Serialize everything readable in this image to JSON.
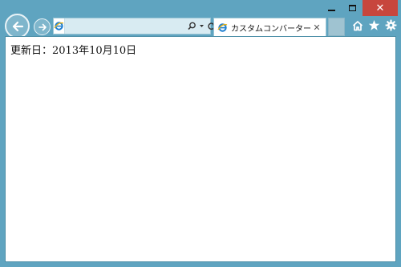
{
  "browser": {
    "address_value": "",
    "tab_title": "カスタムコンバーター",
    "tab_close": "✕",
    "caption_close": "✕"
  },
  "icons": [
    "back-icon",
    "forward-icon",
    "ie-logo-icon",
    "search-icon",
    "dropdown-icon",
    "refresh-icon",
    "home-icon",
    "favorites-icon",
    "settings-icon"
  ],
  "colors": {
    "frame": "#5fa4c0",
    "close_button": "#c7463d",
    "address_bar": "#d8ebf2"
  },
  "page": {
    "updated_text": "更新日：2013年10月10日"
  }
}
